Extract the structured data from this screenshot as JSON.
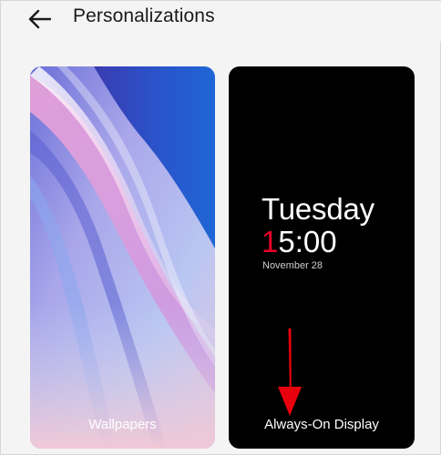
{
  "header": {
    "title": "Personalizations",
    "back_icon": "arrow-left-icon"
  },
  "cards": {
    "wallpapers": {
      "label": "Wallpapers"
    },
    "always_on_display": {
      "label": "Always-On Display",
      "preview": {
        "day": "Tuesday",
        "time_accent": "1",
        "time_rest": "5:00",
        "date": "November 28"
      }
    }
  },
  "colors": {
    "aod_accent": "#eb0029",
    "annotation_arrow": "#e8000c"
  }
}
